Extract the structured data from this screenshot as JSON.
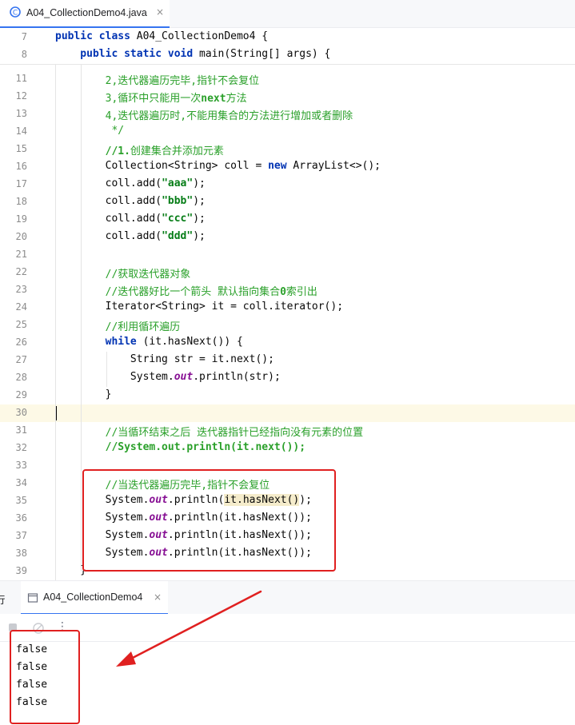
{
  "tab": {
    "filename": "A04_CollectionDemo4.java",
    "close": "×"
  },
  "editor": {
    "sticky_lines": [
      {
        "num": "7",
        "parts": [
          {
            "t": "public class ",
            "c": "kw"
          },
          {
            "t": "A04_CollectionDemo4 {",
            "c": ""
          }
        ]
      },
      {
        "num": "8",
        "parts": [
          {
            "t": "    public static void ",
            "c": "kw"
          },
          {
            "t": "main(String[] args) {",
            "c": ""
          }
        ]
      }
    ],
    "lines": [
      {
        "num": "11",
        "parts": [
          {
            "t": "        2,迭代器遍历完毕,指针不会复位",
            "c": "cmt"
          }
        ]
      },
      {
        "num": "12",
        "parts": [
          {
            "t": "        3,循环中只能用一次",
            "c": "cmt"
          },
          {
            "t": "next",
            "c": "cmt-b"
          },
          {
            "t": "方法",
            "c": "cmt"
          }
        ]
      },
      {
        "num": "13",
        "parts": [
          {
            "t": "        4,迭代器遍历时,不能用集合的方法进行增加或者删除",
            "c": "cmt"
          }
        ]
      },
      {
        "num": "14",
        "parts": [
          {
            "t": "         */",
            "c": "cmt"
          }
        ]
      },
      {
        "num": "15",
        "parts": [
          {
            "t": "        //1.",
            "c": "cmt-b"
          },
          {
            "t": "创建集合并添加元素",
            "c": "cmt"
          }
        ]
      },
      {
        "num": "16",
        "parts": [
          {
            "t": "        Collection<String> coll = ",
            "c": ""
          },
          {
            "t": "new ",
            "c": "kw"
          },
          {
            "t": "ArrayList<>();",
            "c": ""
          }
        ]
      },
      {
        "num": "17",
        "parts": [
          {
            "t": "        coll.add(",
            "c": ""
          },
          {
            "t": "\"aaa\"",
            "c": "str"
          },
          {
            "t": ");",
            "c": ""
          }
        ]
      },
      {
        "num": "18",
        "parts": [
          {
            "t": "        coll.add(",
            "c": ""
          },
          {
            "t": "\"bbb\"",
            "c": "str"
          },
          {
            "t": ");",
            "c": ""
          }
        ]
      },
      {
        "num": "19",
        "parts": [
          {
            "t": "        coll.add(",
            "c": ""
          },
          {
            "t": "\"ccc\"",
            "c": "str"
          },
          {
            "t": ");",
            "c": ""
          }
        ]
      },
      {
        "num": "20",
        "parts": [
          {
            "t": "        coll.add(",
            "c": ""
          },
          {
            "t": "\"ddd\"",
            "c": "str"
          },
          {
            "t": ");",
            "c": ""
          }
        ]
      },
      {
        "num": "21",
        "parts": []
      },
      {
        "num": "22",
        "parts": [
          {
            "t": "        //获取迭代器对象",
            "c": "cmt"
          }
        ]
      },
      {
        "num": "23",
        "parts": [
          {
            "t": "        //迭代器好比一个箭头 默认指向集合",
            "c": "cmt"
          },
          {
            "t": "0",
            "c": "cmt-b"
          },
          {
            "t": "索引出",
            "c": "cmt"
          }
        ]
      },
      {
        "num": "24",
        "parts": [
          {
            "t": "        Iterator<String> it = coll.iterator();",
            "c": ""
          }
        ]
      },
      {
        "num": "25",
        "parts": [
          {
            "t": "        //利用循环遍历",
            "c": "cmt"
          }
        ]
      },
      {
        "num": "26",
        "parts": [
          {
            "t": "        ",
            "c": ""
          },
          {
            "t": "while ",
            "c": "kw"
          },
          {
            "t": "(it.hasNext()) {",
            "c": ""
          }
        ]
      },
      {
        "num": "27",
        "parts": [
          {
            "t": "            String str = it.next();",
            "c": ""
          }
        ]
      },
      {
        "num": "28",
        "parts": [
          {
            "t": "            System.",
            "c": ""
          },
          {
            "t": "out",
            "c": "fld"
          },
          {
            "t": ".println(str);",
            "c": ""
          }
        ]
      },
      {
        "num": "29",
        "parts": [
          {
            "t": "        }",
            "c": ""
          }
        ]
      },
      {
        "num": "30",
        "parts": []
      },
      {
        "num": "31",
        "parts": [
          {
            "t": "        //当循环结束之后 迭代器指针已经指向没有元素的位置",
            "c": "cmt"
          }
        ]
      },
      {
        "num": "32",
        "parts": [
          {
            "t": "        //System.out.println(it.next());",
            "c": "cmt-b"
          }
        ]
      },
      {
        "num": "33",
        "parts": []
      },
      {
        "num": "34",
        "parts": [
          {
            "t": "        //当迭代器遍历完毕,指针不会复位",
            "c": "cmt"
          }
        ]
      },
      {
        "num": "35",
        "parts": [
          {
            "t": "        System.",
            "c": ""
          },
          {
            "t": "out",
            "c": "fld"
          },
          {
            "t": ".println(",
            "c": ""
          },
          {
            "t": "it.hasNext()",
            "c": "hl"
          },
          {
            "t": ");",
            "c": ""
          }
        ]
      },
      {
        "num": "36",
        "parts": [
          {
            "t": "        System.",
            "c": ""
          },
          {
            "t": "out",
            "c": "fld"
          },
          {
            "t": ".println(it.hasNext());",
            "c": ""
          }
        ]
      },
      {
        "num": "37",
        "parts": [
          {
            "t": "        System.",
            "c": ""
          },
          {
            "t": "out",
            "c": "fld"
          },
          {
            "t": ".println(it.hasNext());",
            "c": ""
          }
        ]
      },
      {
        "num": "38",
        "parts": [
          {
            "t": "        System.",
            "c": ""
          },
          {
            "t": "out",
            "c": "fld"
          },
          {
            "t": ".println(it.hasNext());",
            "c": ""
          }
        ]
      },
      {
        "num": "39",
        "parts": [
          {
            "t": "    }",
            "c": ""
          }
        ]
      }
    ]
  },
  "run_panel": {
    "side_label": "行",
    "tab_label": "A04_CollectionDemo4",
    "close": "×",
    "more": "⋮",
    "output": [
      "false",
      "false",
      "false",
      "false"
    ]
  },
  "colors": {
    "accent": "#3574f0",
    "annotation": "#e02020"
  }
}
